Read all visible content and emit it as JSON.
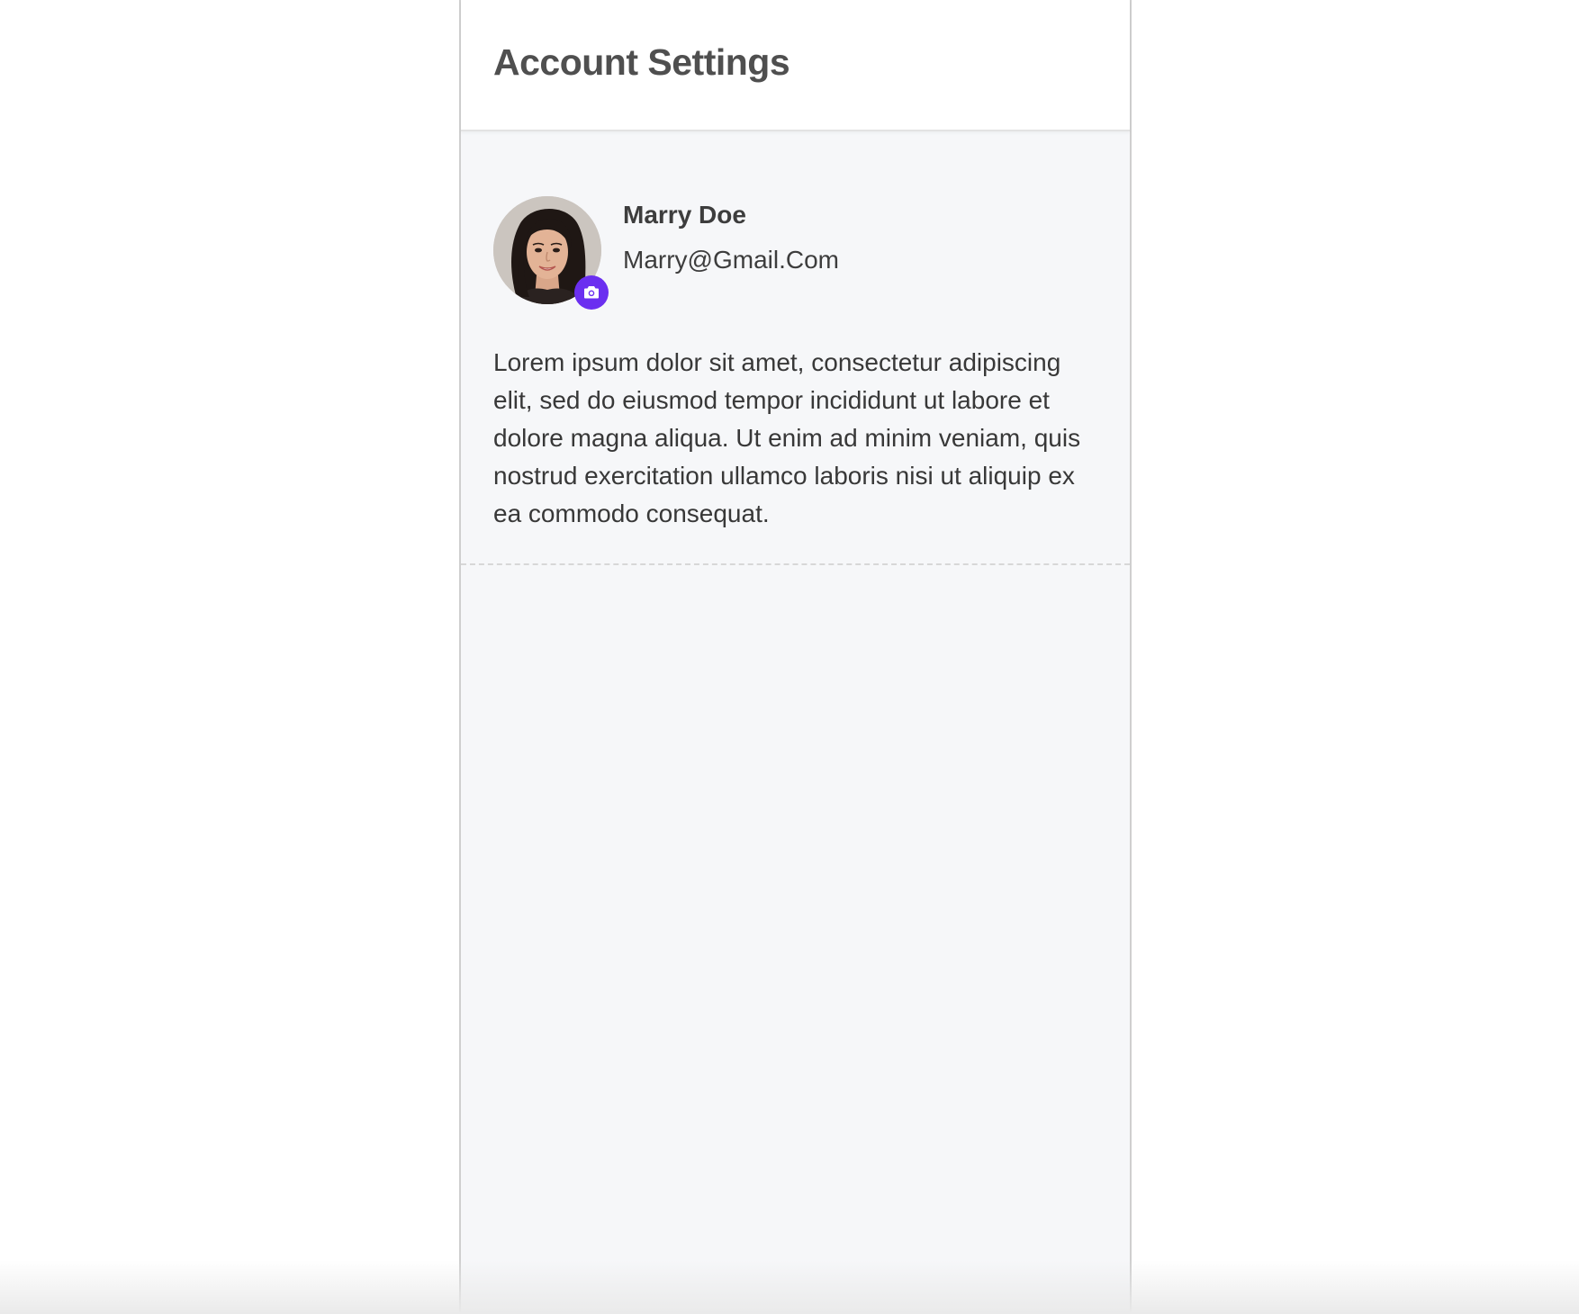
{
  "header": {
    "title": "Account Settings"
  },
  "profile": {
    "name": "Marry Doe",
    "email": "Marry@Gmail.Com",
    "avatar_icon": "user-photo",
    "change_photo_icon": "camera-icon",
    "bio": "Lorem ipsum dolor sit amet, consectetur adipiscing elit, sed do eiusmod tempor incididunt ut labore et dolore magna aliqua. Ut enim ad minim veniam, quis nostrud exercitation ullamco laboris nisi ut aliquip ex ea commodo consequat."
  },
  "colors": {
    "accent": "#6b2ff0",
    "panel_background": "#f6f7f9",
    "title_text": "#4f4f4f",
    "body_text": "#383838"
  }
}
